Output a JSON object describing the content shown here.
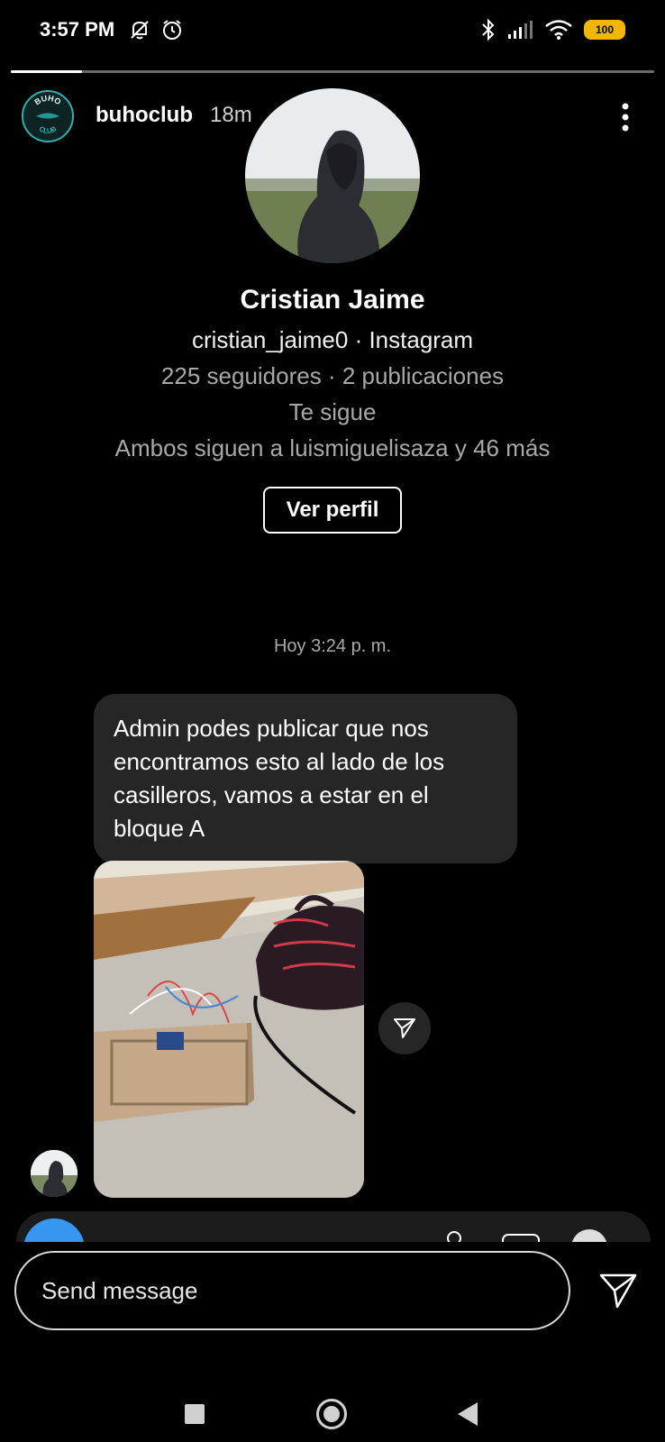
{
  "status_bar": {
    "time": "3:57 PM",
    "battery": "100",
    "icons": [
      "mute-icon",
      "alarm-icon",
      "bluetooth-icon",
      "signal-icon",
      "wifi-icon",
      "battery-icon"
    ]
  },
  "story": {
    "progress": 0.11,
    "username": "buhoclub",
    "time_ago": "18m",
    "avatar_text_top": "BUHO",
    "avatar_text_bottom": "CLUB"
  },
  "profile_card": {
    "name": "Cristian Jaime",
    "handle_line": "cristian_jaime0 · Instagram",
    "stats_line": "225 seguidores · 2 publicaciones",
    "follows_you": "Te sigue",
    "mutual_line": "Ambos siguen a luismiguelisaza y 46 más",
    "view_profile_label": "Ver perfil"
  },
  "conversation": {
    "timestamp": "Hoy 3:24 p. m.",
    "message_text": "Admin podes publicar que nos encontramos esto al lado de los casilleros, vamos a estar en el bloque A"
  },
  "reply": {
    "placeholder": "Send message"
  },
  "colors": {
    "background": "#000000",
    "bubble": "#262626",
    "accent_teal": "#2bb1b1",
    "battery": "#f2b705"
  }
}
